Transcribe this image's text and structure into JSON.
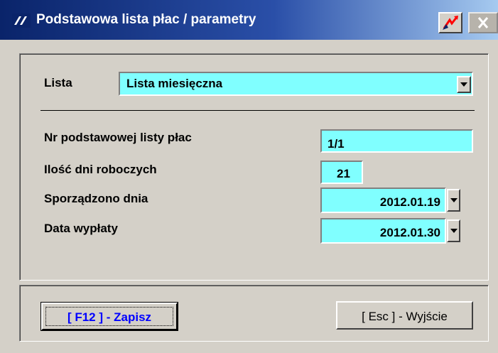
{
  "window": {
    "title": "Podstawowa lista płac / parametry",
    "icon": "app-logo-icon",
    "special_button_icon": "chart-arrow-icon",
    "close_button_icon": "close-icon"
  },
  "form": {
    "list_label": "Lista",
    "list_value": "Lista miesięczna",
    "payroll_no_label": "Nr podstawowej listy płac",
    "payroll_no_value": "1/1",
    "workdays_label": "Ilość dni roboczych",
    "workdays_value": "21",
    "created_label": "Sporządzono dnia",
    "created_value": "2012.01.19",
    "payout_label": "Data wypłaty",
    "payout_value": "2012.01.30"
  },
  "buttons": {
    "save_label": "[ F12 ] - Zapisz",
    "exit_label": "[ Esc ] - Wyjście"
  },
  "colors": {
    "field_bg": "#80ffff",
    "titlebar": "#0a246a",
    "save_text": "#0000ff"
  }
}
